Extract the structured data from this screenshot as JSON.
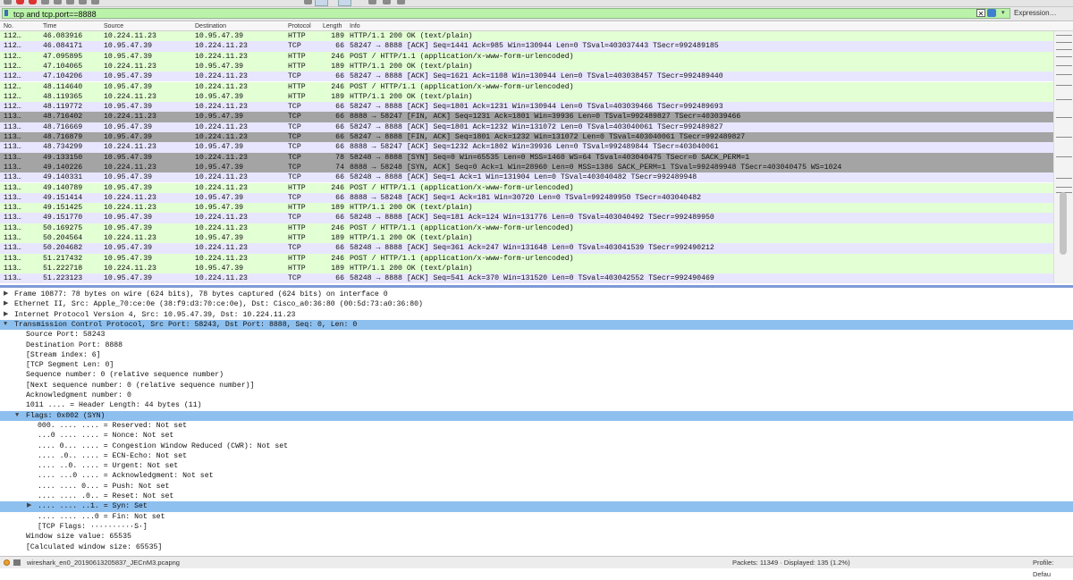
{
  "filter": {
    "value": "tcp and tcp.port==8888",
    "expression_label": "Expression…",
    "clear_glyph": "✕",
    "history_glyph": "▾"
  },
  "columns": {
    "no": "No.",
    "time": "Time",
    "source": "Source",
    "destination": "Destination",
    "protocol": "Protocol",
    "length": "Length",
    "info": "Info"
  },
  "packets": [
    {
      "no": "112…",
      "time": "46.083916",
      "src": "10.224.11.23",
      "dst": "10.95.47.39",
      "proto": "HTTP",
      "len": "189",
      "info": "HTTP/1.1 200 OK  (text/plain)",
      "kind": "http"
    },
    {
      "no": "112…",
      "time": "46.084171",
      "src": "10.95.47.39",
      "dst": "10.224.11.23",
      "proto": "TCP",
      "len": "66",
      "info": "58247 → 8888 [ACK] Seq=1441 Ack=985 Win=130944 Len=0 TSval=403037443 TSecr=992489185",
      "kind": "tcp"
    },
    {
      "no": "112…",
      "time": "47.095895",
      "src": "10.95.47.39",
      "dst": "10.224.11.23",
      "proto": "HTTP",
      "len": "246",
      "info": "POST / HTTP/1.1  (application/x-www-form-urlencoded)",
      "kind": "http"
    },
    {
      "no": "112…",
      "time": "47.104065",
      "src": "10.224.11.23",
      "dst": "10.95.47.39",
      "proto": "HTTP",
      "len": "189",
      "info": "HTTP/1.1 200 OK  (text/plain)",
      "kind": "http"
    },
    {
      "no": "112…",
      "time": "47.104206",
      "src": "10.95.47.39",
      "dst": "10.224.11.23",
      "proto": "TCP",
      "len": "66",
      "info": "58247 → 8888 [ACK] Seq=1621 Ack=1108 Win=130944 Len=0 TSval=403038457 TSecr=992489440",
      "kind": "tcp"
    },
    {
      "no": "112…",
      "time": "48.114640",
      "src": "10.95.47.39",
      "dst": "10.224.11.23",
      "proto": "HTTP",
      "len": "246",
      "info": "POST / HTTP/1.1  (application/x-www-form-urlencoded)",
      "kind": "http"
    },
    {
      "no": "112…",
      "time": "48.119365",
      "src": "10.224.11.23",
      "dst": "10.95.47.39",
      "proto": "HTTP",
      "len": "189",
      "info": "HTTP/1.1 200 OK  (text/plain)",
      "kind": "http"
    },
    {
      "no": "112…",
      "time": "48.119772",
      "src": "10.95.47.39",
      "dst": "10.224.11.23",
      "proto": "TCP",
      "len": "66",
      "info": "58247 → 8888 [ACK] Seq=1801 Ack=1231 Win=130944 Len=0 TSval=403039466 TSecr=992489693",
      "kind": "tcp"
    },
    {
      "no": "113…",
      "time": "48.716402",
      "src": "10.224.11.23",
      "dst": "10.95.47.39",
      "proto": "TCP",
      "len": "66",
      "info": "8888 → 58247 [FIN, ACK] Seq=1231 Ack=1801 Win=39936 Len=0 TSval=992489827 TSecr=403039466",
      "kind": "fin"
    },
    {
      "no": "113…",
      "time": "48.716669",
      "src": "10.95.47.39",
      "dst": "10.224.11.23",
      "proto": "TCP",
      "len": "66",
      "info": "58247 → 8888 [ACK] Seq=1801 Ack=1232 Win=131072 Len=0 TSval=403040061 TSecr=992489827",
      "kind": "tcp"
    },
    {
      "no": "113…",
      "time": "48.716879",
      "src": "10.95.47.39",
      "dst": "10.224.11.23",
      "proto": "TCP",
      "len": "66",
      "info": "58247 → 8888 [FIN, ACK] Seq=1801 Ack=1232 Win=131072 Len=0 TSval=403040061 TSecr=992489827",
      "kind": "fin"
    },
    {
      "no": "113…",
      "time": "48.734299",
      "src": "10.224.11.23",
      "dst": "10.95.47.39",
      "proto": "TCP",
      "len": "66",
      "info": "8888 → 58247 [ACK] Seq=1232 Ack=1802 Win=39936 Len=0 TSval=992489844 TSecr=403040061",
      "kind": "tcp"
    },
    {
      "no": "113…",
      "time": "49.133150",
      "src": "10.95.47.39",
      "dst": "10.224.11.23",
      "proto": "TCP",
      "len": "78",
      "info": "58248 → 8888 [SYN] Seq=0 Win=65535 Len=0 MSS=1460 WS=64 TSval=403040475 TSecr=0 SACK_PERM=1",
      "kind": "fin"
    },
    {
      "no": "113…",
      "time": "49.140226",
      "src": "10.224.11.23",
      "dst": "10.95.47.39",
      "proto": "TCP",
      "len": "74",
      "info": "8888 → 58248 [SYN, ACK] Seq=0 Ack=1 Win=28960 Len=0 MSS=1386 SACK_PERM=1 TSval=992489948 TSecr=403040475 WS=1024",
      "kind": "fin"
    },
    {
      "no": "113…",
      "time": "49.140331",
      "src": "10.95.47.39",
      "dst": "10.224.11.23",
      "proto": "TCP",
      "len": "66",
      "info": "58248 → 8888 [ACK] Seq=1 Ack=1 Win=131904 Len=0 TSval=403040482 TSecr=992489948",
      "kind": "tcp"
    },
    {
      "no": "113…",
      "time": "49.140789",
      "src": "10.95.47.39",
      "dst": "10.224.11.23",
      "proto": "HTTP",
      "len": "246",
      "info": "POST / HTTP/1.1  (application/x-www-form-urlencoded)",
      "kind": "http"
    },
    {
      "no": "113…",
      "time": "49.151414",
      "src": "10.224.11.23",
      "dst": "10.95.47.39",
      "proto": "TCP",
      "len": "66",
      "info": "8888 → 58248 [ACK] Seq=1 Ack=181 Win=30720 Len=0 TSval=992489950 TSecr=403040482",
      "kind": "tcp"
    },
    {
      "no": "113…",
      "time": "49.151425",
      "src": "10.224.11.23",
      "dst": "10.95.47.39",
      "proto": "HTTP",
      "len": "189",
      "info": "HTTP/1.1 200 OK  (text/plain)",
      "kind": "http"
    },
    {
      "no": "113…",
      "time": "49.151770",
      "src": "10.95.47.39",
      "dst": "10.224.11.23",
      "proto": "TCP",
      "len": "66",
      "info": "58248 → 8888 [ACK] Seq=181 Ack=124 Win=131776 Len=0 TSval=403040492 TSecr=992489950",
      "kind": "tcp"
    },
    {
      "no": "113…",
      "time": "50.169275",
      "src": "10.95.47.39",
      "dst": "10.224.11.23",
      "proto": "HTTP",
      "len": "246",
      "info": "POST / HTTP/1.1  (application/x-www-form-urlencoded)",
      "kind": "http"
    },
    {
      "no": "113…",
      "time": "50.204564",
      "src": "10.224.11.23",
      "dst": "10.95.47.39",
      "proto": "HTTP",
      "len": "189",
      "info": "HTTP/1.1 200 OK  (text/plain)",
      "kind": "http"
    },
    {
      "no": "113…",
      "time": "50.204682",
      "src": "10.95.47.39",
      "dst": "10.224.11.23",
      "proto": "TCP",
      "len": "66",
      "info": "58248 → 8888 [ACK] Seq=361 Ack=247 Win=131648 Len=0 TSval=403041539 TSecr=992490212",
      "kind": "tcp"
    },
    {
      "no": "113…",
      "time": "51.217432",
      "src": "10.95.47.39",
      "dst": "10.224.11.23",
      "proto": "HTTP",
      "len": "246",
      "info": "POST / HTTP/1.1  (application/x-www-form-urlencoded)",
      "kind": "http"
    },
    {
      "no": "113…",
      "time": "51.222718",
      "src": "10.224.11.23",
      "dst": "10.95.47.39",
      "proto": "HTTP",
      "len": "189",
      "info": "HTTP/1.1 200 OK  (text/plain)",
      "kind": "http"
    },
    {
      "no": "113…",
      "time": "51.223123",
      "src": "10.95.47.39",
      "dst": "10.224.11.23",
      "proto": "TCP",
      "len": "66",
      "info": "58248 → 8888 [ACK] Seq=541 Ack=370 Win=131520 Len=0 TSval=403042552 TSecr=992490469",
      "kind": "tcp"
    }
  ],
  "details": [
    {
      "text": "Frame 10877: 78 bytes on wire (624 bits), 78 bytes captured (624 bits) on interface 0",
      "indent": 0,
      "tri": "▶",
      "hl": false
    },
    {
      "text": "Ethernet II, Src: Apple_70:ce:0e (38:f9:d3:70:ce:0e), Dst: Cisco_a0:36:80 (00:5d:73:a0:36:80)",
      "indent": 0,
      "tri": "▶",
      "hl": false
    },
    {
      "text": "Internet Protocol Version 4, Src: 10.95.47.39, Dst: 10.224.11.23",
      "indent": 0,
      "tri": "▶",
      "hl": false
    },
    {
      "text": "Transmission Control Protocol, Src Port: 58243, Dst Port: 8888, Seq: 0, Len: 0",
      "indent": 0,
      "tri": "▼",
      "hl": true
    },
    {
      "text": "Source Port: 58243",
      "indent": 1,
      "tri": "",
      "hl": false
    },
    {
      "text": "Destination Port: 8888",
      "indent": 1,
      "tri": "",
      "hl": false
    },
    {
      "text": "[Stream index: 6]",
      "indent": 1,
      "tri": "",
      "hl": false
    },
    {
      "text": "[TCP Segment Len: 0]",
      "indent": 1,
      "tri": "",
      "hl": false
    },
    {
      "text": "Sequence number: 0    (relative sequence number)",
      "indent": 1,
      "tri": "",
      "hl": false
    },
    {
      "text": "[Next sequence number: 0    (relative sequence number)]",
      "indent": 1,
      "tri": "",
      "hl": false
    },
    {
      "text": "Acknowledgment number: 0",
      "indent": 1,
      "tri": "",
      "hl": false
    },
    {
      "text": "1011 .... = Header Length: 44 bytes (11)",
      "indent": 1,
      "tri": "",
      "hl": false
    },
    {
      "text": "Flags: 0x002 (SYN)",
      "indent": 1,
      "tri": "▼",
      "hl": true
    },
    {
      "text": "000. .... .... = Reserved: Not set",
      "indent": 2,
      "tri": "",
      "hl": false
    },
    {
      "text": "...0 .... .... = Nonce: Not set",
      "indent": 2,
      "tri": "",
      "hl": false
    },
    {
      "text": ".... 0... .... = Congestion Window Reduced (CWR): Not set",
      "indent": 2,
      "tri": "",
      "hl": false
    },
    {
      "text": ".... .0.. .... = ECN-Echo: Not set",
      "indent": 2,
      "tri": "",
      "hl": false
    },
    {
      "text": ".... ..0. .... = Urgent: Not set",
      "indent": 2,
      "tri": "",
      "hl": false
    },
    {
      "text": ".... ...0 .... = Acknowledgment: Not set",
      "indent": 2,
      "tri": "",
      "hl": false
    },
    {
      "text": ".... .... 0... = Push: Not set",
      "indent": 2,
      "tri": "",
      "hl": false
    },
    {
      "text": ".... .... .0.. = Reset: Not set",
      "indent": 2,
      "tri": "",
      "hl": false
    },
    {
      "text": ".... .... ..1. = Syn: Set",
      "indent": 2,
      "tri": "▶",
      "hl": true
    },
    {
      "text": ".... .... ...0 = Fin: Not set",
      "indent": 2,
      "tri": "",
      "hl": false
    },
    {
      "text": "[TCP Flags: ··········S·]",
      "indent": 2,
      "tri": "",
      "hl": false
    },
    {
      "text": "Window size value: 65535",
      "indent": 1,
      "tri": "",
      "hl": false
    },
    {
      "text": "[Calculated window size: 65535]",
      "indent": 1,
      "tri": "",
      "hl": false
    }
  ],
  "status": {
    "file": "wireshark_en0_20190613205837_JECnM3.pcapng",
    "packets": "Packets: 11349 · Displayed: 135 (1.2%)",
    "profile": "Profile: Defau"
  },
  "colors": {
    "http_row": "#e3ffd4",
    "tcp_row": "#e8e6ff",
    "fin_row": "#a4a4a4",
    "highlight": "#8ec0ef",
    "filter_ok": "#b9f2a8"
  }
}
